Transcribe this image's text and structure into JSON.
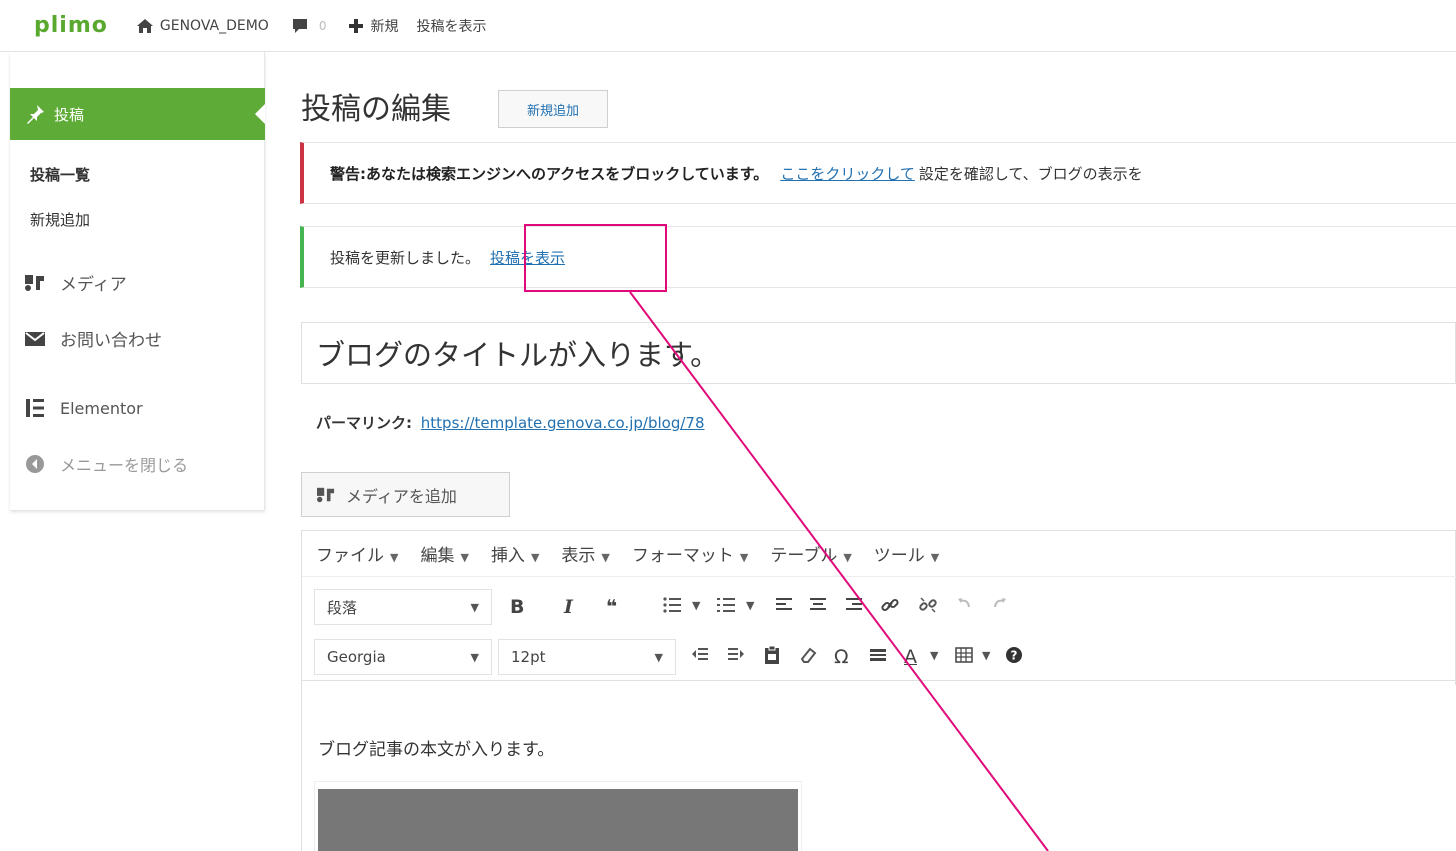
{
  "adminbar": {
    "logo": "plimo",
    "site_name": "GENOVA_DEMO",
    "comment_count": "0",
    "new_label": "新規",
    "view_post": "投稿を表示"
  },
  "sidebar": {
    "active_label": "投稿",
    "submenu": [
      "投稿一覧",
      "新規追加"
    ],
    "items": [
      {
        "label": "メディア",
        "icon": "media-icon"
      },
      {
        "label": "お問い合わせ",
        "icon": "mail-icon"
      },
      {
        "label": "Elementor",
        "icon": "elementor-icon"
      },
      {
        "label": "メニューを閉じる",
        "icon": "collapse-icon"
      }
    ]
  },
  "main": {
    "page_title": "投稿の編集",
    "add_new": "新規追加",
    "warning": {
      "text": "警告:あなたは検索エンジンへのアクセスをブロックしています。",
      "link": "ここをクリックして",
      "rest": "設定を確認して、ブログの表示を"
    },
    "updated": {
      "text": "投稿を更新しました。",
      "link": "投稿を表示"
    },
    "post_title": "ブログのタイトルが入ります。",
    "permalink_label": "パーマリンク:",
    "permalink_url": "https://template.genova.co.jp/blog/78",
    "add_media": "メディアを追加"
  },
  "editor": {
    "menus": [
      "ファイル",
      "編集",
      "挿入",
      "表示",
      "フォーマット",
      "テーブル",
      "ツール"
    ],
    "block_format": "段落",
    "font_family": "Georgia",
    "font_size": "12pt",
    "content": "ブログ記事の本文が入ります。"
  },
  "colors": {
    "brand": "#59a82f",
    "active_menu": "#5eac37",
    "link": "#2271b1",
    "warning_border": "#cc3344",
    "success_border": "#46b450",
    "annotation": "#e0097a"
  }
}
